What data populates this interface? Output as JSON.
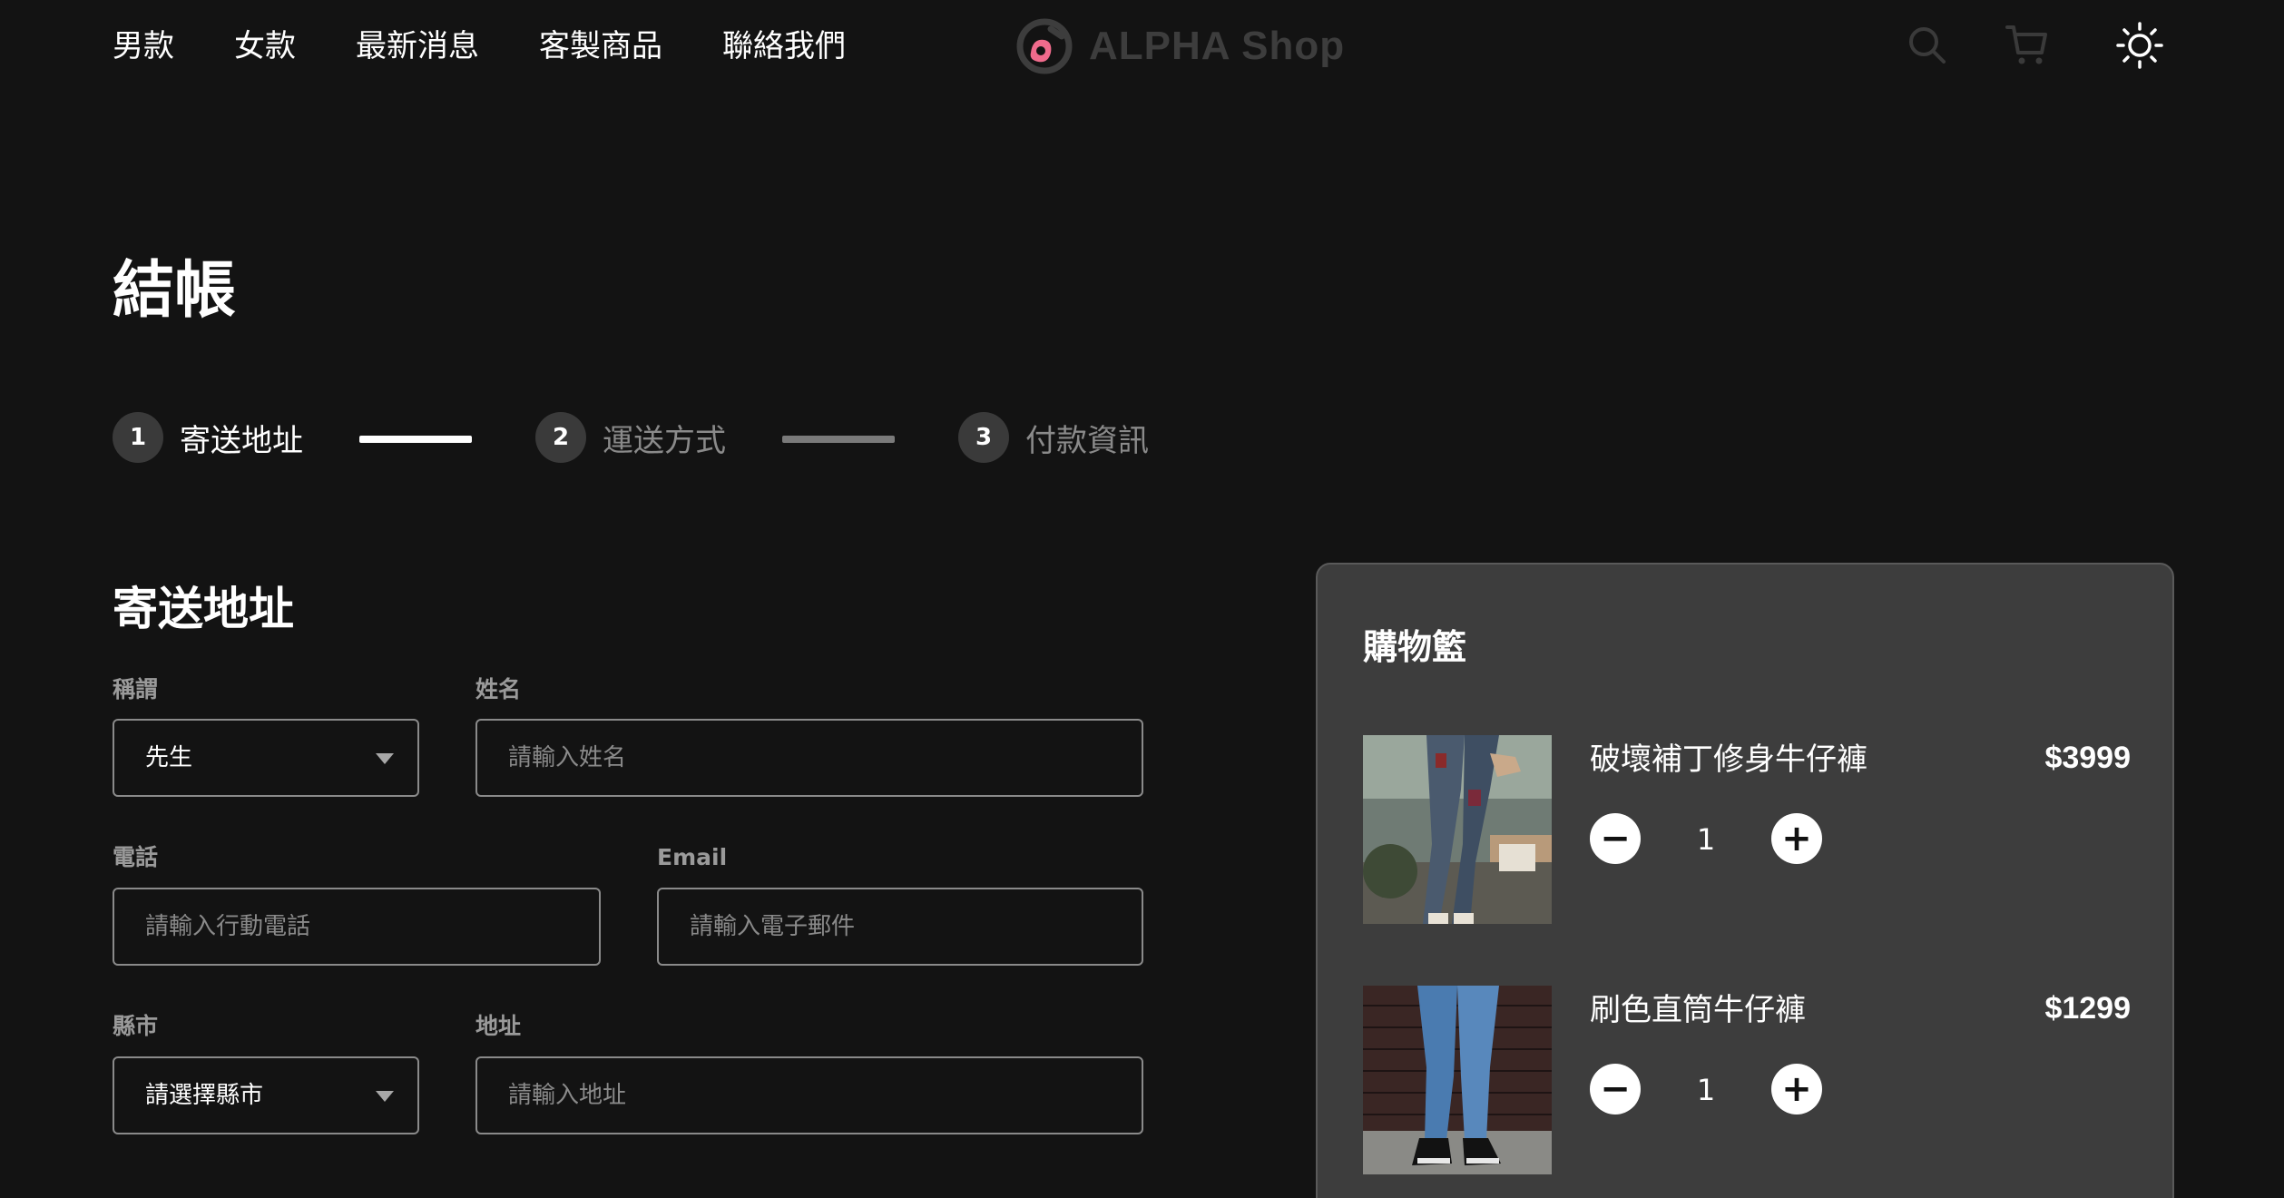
{
  "header": {
    "nav": [
      "男款",
      "女款",
      "最新消息",
      "客製商品",
      "聯絡我們"
    ],
    "logo_text": "ALPHA Shop",
    "icons": [
      "search-icon",
      "cart-icon",
      "sun-icon"
    ]
  },
  "page": {
    "title": "結帳"
  },
  "stepper": {
    "steps": [
      {
        "number": "1",
        "label": "寄送地址",
        "state": "active"
      },
      {
        "number": "2",
        "label": "運送方式",
        "state": "inactive"
      },
      {
        "number": "3",
        "label": "付款資訊",
        "state": "inactive"
      }
    ]
  },
  "form": {
    "section_title": "寄送地址",
    "salutation": {
      "label": "稱謂",
      "value": "先生"
    },
    "name": {
      "label": "姓名",
      "placeholder": "請輸入姓名"
    },
    "phone": {
      "label": "電話",
      "placeholder": "請輸入行動電話"
    },
    "email": {
      "label": "Email",
      "placeholder": "請輸入電子郵件"
    },
    "city": {
      "label": "縣市",
      "value": "請選擇縣市"
    },
    "address": {
      "label": "地址",
      "placeholder": "請輸入地址"
    }
  },
  "cart": {
    "title": "購物籃",
    "items": [
      {
        "name": "破壞補丁修身牛仔褲",
        "price": "$3999",
        "quantity": "1"
      },
      {
        "name": "刷色直筒牛仔褲",
        "price": "$1299",
        "quantity": "1"
      }
    ],
    "minus_symbol": "−",
    "plus_symbol": "+"
  },
  "colors": {
    "background": "#131313",
    "cart_panel": "#3d3d3d",
    "step_line_active": "#ffffff",
    "step_line_inactive": "#7a7a7a",
    "logo_accent": "#f06b8c"
  }
}
